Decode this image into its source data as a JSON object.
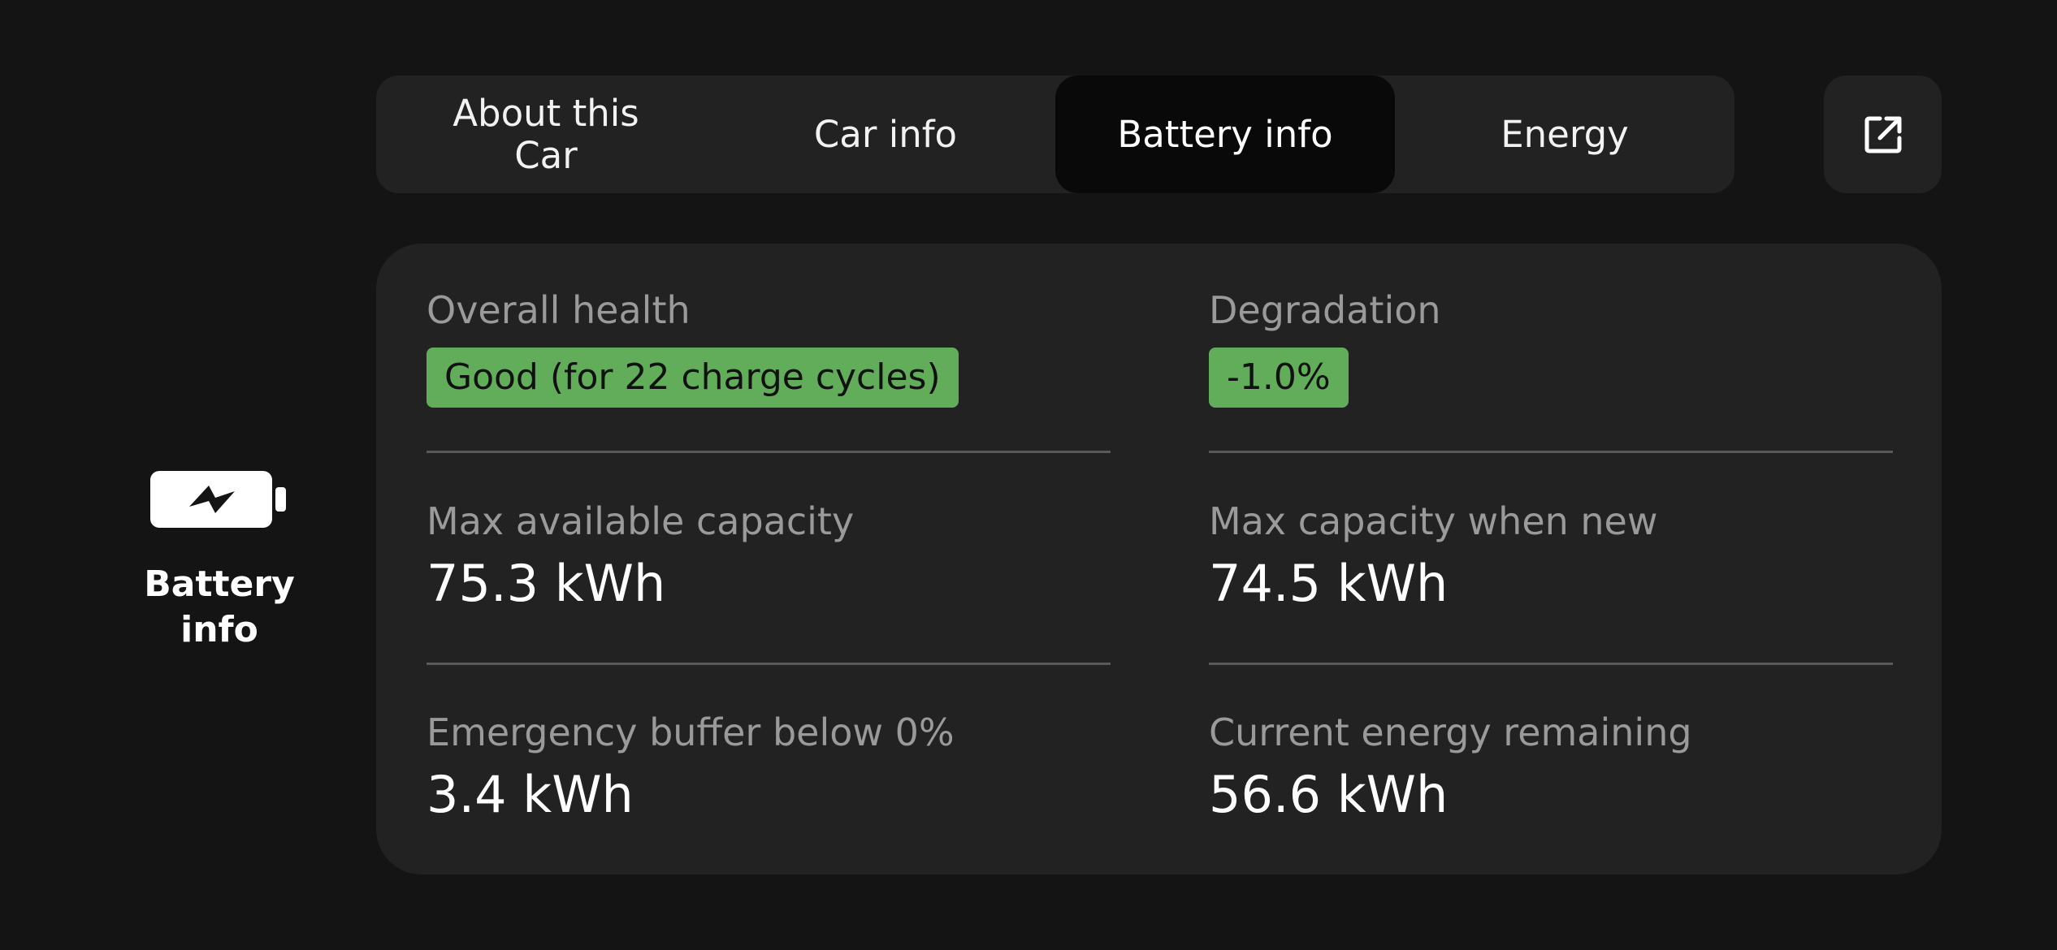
{
  "side": {
    "icon": "battery-charging-icon",
    "label": "Battery info"
  },
  "tabs": [
    {
      "label": "About this Car",
      "active": false
    },
    {
      "label": "Car info",
      "active": false
    },
    {
      "label": "Battery info",
      "active": true
    },
    {
      "label": "Energy",
      "active": false
    }
  ],
  "toolbar": {
    "external_icon": "open-external-icon"
  },
  "battery": {
    "overall_health": {
      "label": "Overall health",
      "value": "Good (for 22 charge cycles)"
    },
    "degradation": {
      "label": "Degradation",
      "value": "-1.0%"
    },
    "max_available_capacity": {
      "label": "Max available capacity",
      "value": "75.3 kWh"
    },
    "max_capacity_new": {
      "label": "Max capacity when new",
      "value": "74.5 kWh"
    },
    "emergency_buffer": {
      "label": "Emergency buffer below 0%",
      "value": "3.4 kWh"
    },
    "current_energy": {
      "label": "Current energy remaining",
      "value": "56.6 kWh"
    }
  },
  "colors": {
    "background": "#141414",
    "surface": "#222222",
    "active_tab": "#090909",
    "good_badge": "#62ad5a",
    "muted_text": "#9a9a9a"
  }
}
